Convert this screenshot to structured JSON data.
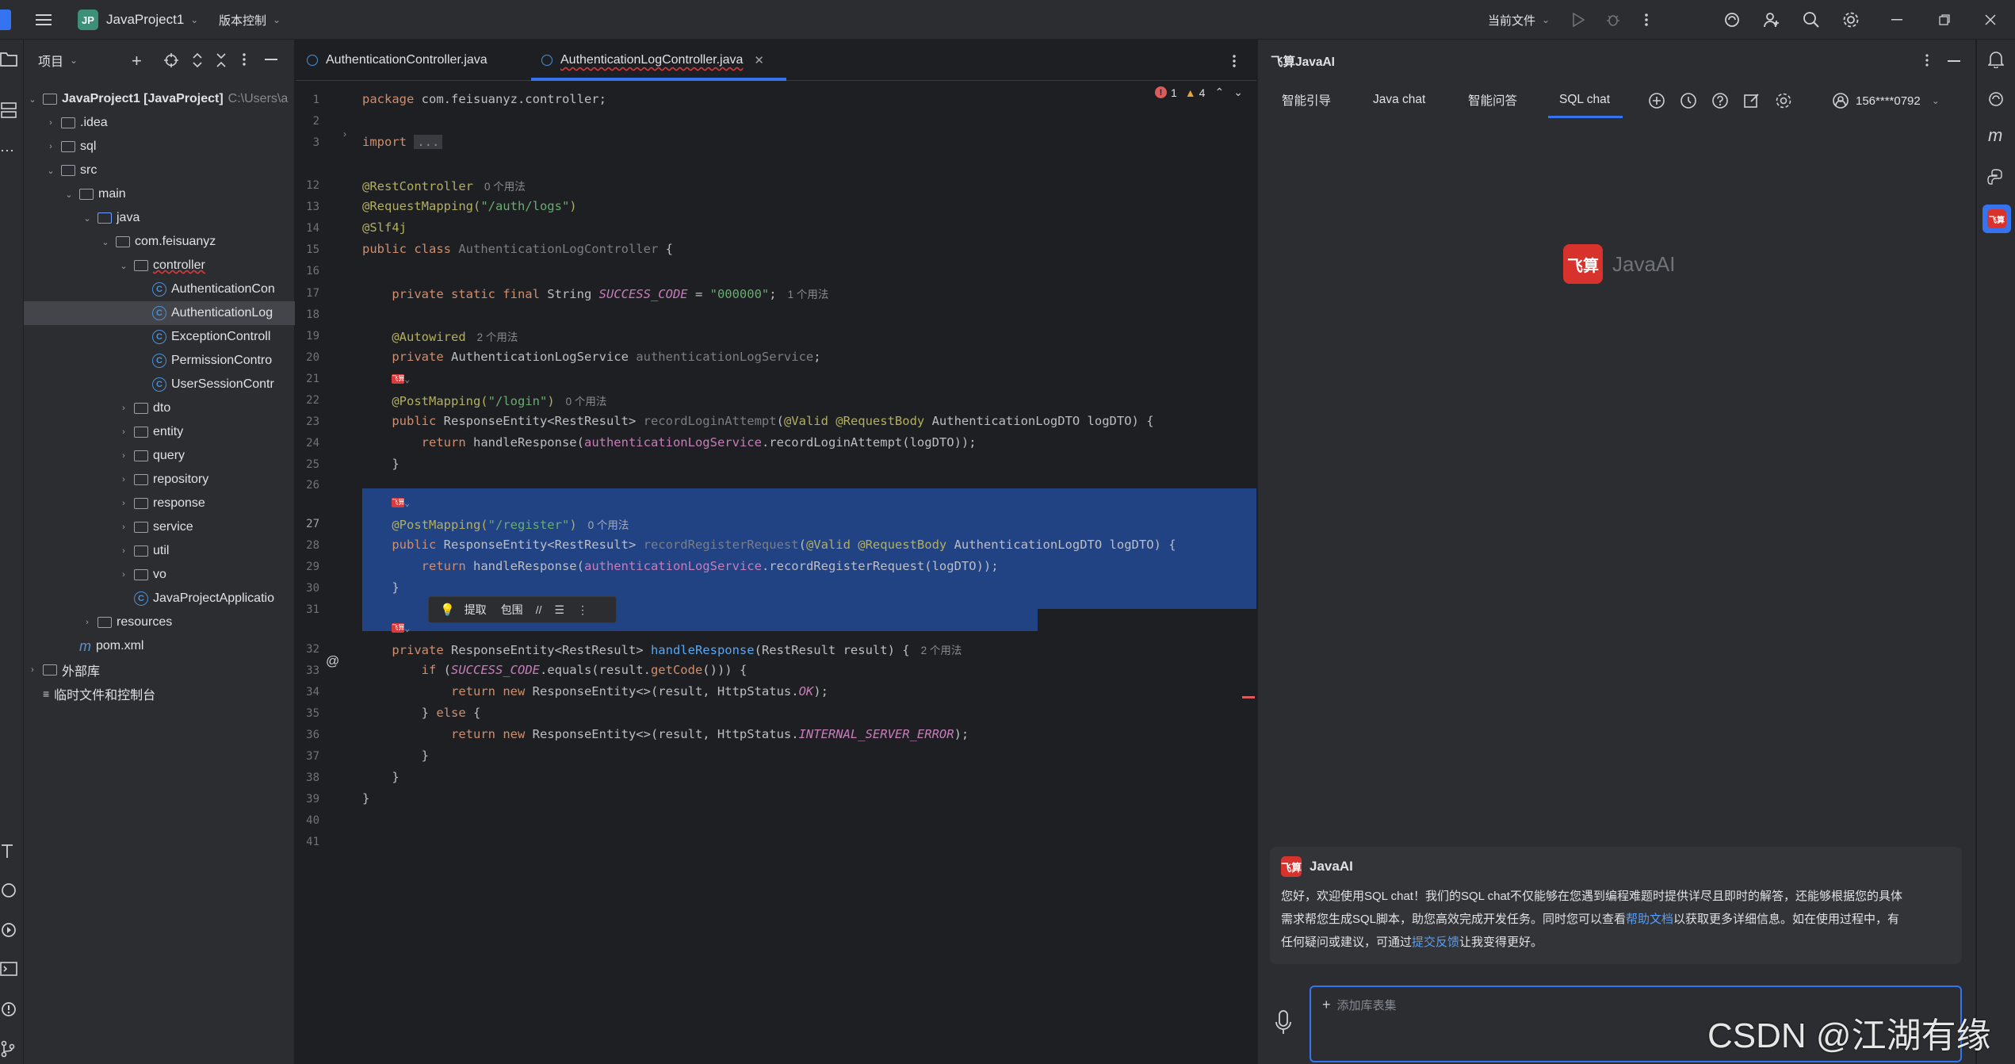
{
  "titlebar": {
    "project_badge": "JP",
    "project_name": "JavaProject1",
    "vcs_label": "版本控制",
    "run_config": "当前文件"
  },
  "project_panel": {
    "title": "项目",
    "rows": [
      {
        "label": "JavaProject1 [JavaProject]",
        "suffix": "C:\\Users\\a"
      },
      {
        "label": ".idea"
      },
      {
        "label": "sql"
      },
      {
        "label": "src"
      },
      {
        "label": "main"
      },
      {
        "label": "java"
      },
      {
        "label": "com.feisuanyz"
      },
      {
        "label": "controller"
      },
      {
        "label": "AuthenticationCon"
      },
      {
        "label": "AuthenticationLog"
      },
      {
        "label": "ExceptionControll"
      },
      {
        "label": "PermissionContro"
      },
      {
        "label": "UserSessionContr"
      },
      {
        "label": "dto"
      },
      {
        "label": "entity"
      },
      {
        "label": "query"
      },
      {
        "label": "repository"
      },
      {
        "label": "response"
      },
      {
        "label": "service"
      },
      {
        "label": "util"
      },
      {
        "label": "vo"
      },
      {
        "label": "JavaProjectApplicatio"
      },
      {
        "label": "resources"
      },
      {
        "label": "pom.xml"
      },
      {
        "label": "外部库"
      },
      {
        "label": "临时文件和控制台"
      }
    ]
  },
  "editor": {
    "tabs": [
      "AuthenticationController.java",
      "AuthenticationLogController.java"
    ],
    "error_count": "1",
    "warning_count": "4",
    "line_numbers": [
      "1",
      "2",
      "3",
      "12",
      "13",
      "14",
      "15",
      "16",
      "17",
      "18",
      "19",
      "20",
      "21",
      "22",
      "23",
      "24",
      "25",
      "26",
      "27",
      "28",
      "29",
      "30",
      "31",
      "32",
      "33",
      "34",
      "35",
      "36",
      "37",
      "38",
      "39",
      "40",
      "41"
    ],
    "hints": {
      "usages0": "0 个用法",
      "usages1": "1 个用法",
      "usages2": "2 个用法"
    },
    "code": {
      "package_kw": "package",
      "package_name": " com.feisuanyz.controller;",
      "import_kw": "import",
      "import_fold": "...",
      "rest_controller": "@RestController",
      "request_mapping": "@RequestMapping(",
      "request_mapping_path": "\"/auth/logs\"",
      "slf4j": "@Slf4j",
      "class_decl_kw": "public class ",
      "class_name": "AuthenticationLogController",
      "private_static_final": "private static final ",
      "string_type": "String ",
      "success_code": "SUCCESS_CODE",
      "success_value": "\"000000\"",
      "autowired": "@Autowired",
      "private_kw": "private ",
      "service_type": "AuthenticationLogService ",
      "service_field": "authenticationLogService",
      "post_mapping": "@PostMapping(",
      "login_path": "\"/login\"",
      "register_path": "\"/register\"",
      "public_kw": "public ",
      "response_entity": "ResponseEntity<RestResult> ",
      "record_login": "recordLoginAttempt",
      "valid_ann": "@Valid @RequestBody ",
      "dto_param": "AuthenticationLogDTO logDTO) {",
      "return_kw": "return ",
      "handle_response": "handleResponse",
      "login_call": ".recordLoginAttempt(logDTO));",
      "record_register": "recordRegisterRequest",
      "register_call": ".recordRegisterRequest(logDTO));",
      "handle_sig": "(RestResult result) {",
      "if_kw": "if ",
      "equals_call": ".equals(result.",
      "get_code": "getCode",
      "new_kw": "new ",
      "response_ctor": "ResponseEntity<>(result, HttpStatus.",
      "ok": "OK",
      "else_kw": "else ",
      "internal_error": "INTERNAL_SERVER_ERROR"
    },
    "popup": {
      "extract": "提取",
      "surround": "包围"
    },
    "marker_text": "飞算"
  },
  "ai_panel": {
    "title": "飞算JavaAI",
    "tabs": [
      "智能引导",
      "Java chat",
      "智能问答",
      "SQL chat"
    ],
    "user": "156****0792",
    "logo_text": "JavaAI",
    "logo_mark": "飞算",
    "message": {
      "sender": "JavaAI",
      "line1": "您好，欢迎使用SQL chat！我们的SQL chat不仅能够在您遇到编程难题时提供详尽且即时的解答，还能够根据您的具体",
      "line2a": "需求帮您生成SQL脚本，助您高效完成开发任务。同时您可以查看",
      "link1": "帮助文档",
      "line2b": "以获取更多详细信息。如在使用过程中，有",
      "line3a": "任何疑问或建议，可通过",
      "link2": "提交反馈",
      "line3b": "让我变得更好。"
    },
    "add_table_placeholder": "添加库表集"
  },
  "watermark": "CSDN @江湖有缘",
  "colors": {
    "accent": "#3574f0",
    "selection": "#214283",
    "brand_red": "#d8322d"
  }
}
